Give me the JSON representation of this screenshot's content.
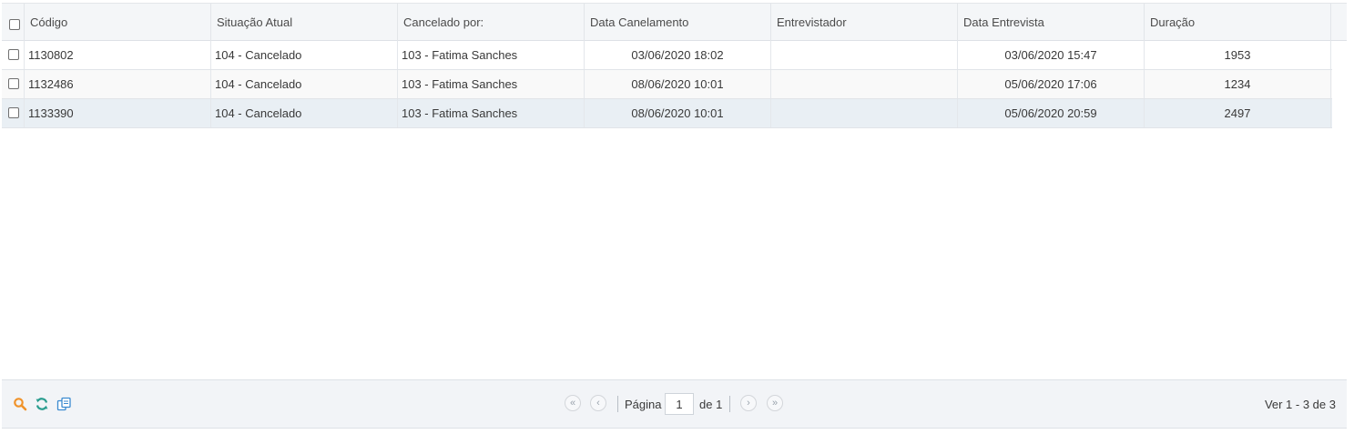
{
  "columns": {
    "codigo": "Código",
    "situacao": "Situação Atual",
    "cancelado_por": "Cancelado por:",
    "data_cancelamento": "Data Canelamento",
    "entrevistador": "Entrevistador",
    "data_entrevista": "Data Entrevista",
    "duracao": "Duração"
  },
  "rows": [
    {
      "codigo": "1130802",
      "situacao": "104 - Cancelado",
      "cancelado_por": "103 - Fatima Sanches",
      "data_cancelamento": "03/06/2020 18:02",
      "entrevistador": "",
      "data_entrevista": "03/06/2020 15:47",
      "duracao": "1953"
    },
    {
      "codigo": "1132486",
      "situacao": "104 - Cancelado",
      "cancelado_por": "103 - Fatima Sanches",
      "data_cancelamento": "08/06/2020 10:01",
      "entrevistador": "",
      "data_entrevista": "05/06/2020 17:06",
      "duracao": "1234"
    },
    {
      "codigo": "1133390",
      "situacao": "104 - Cancelado",
      "cancelado_por": "103 - Fatima Sanches",
      "data_cancelamento": "08/06/2020 10:01",
      "entrevistador": "",
      "data_entrevista": "05/06/2020 20:59",
      "duracao": "2497"
    }
  ],
  "pager": {
    "page_label": "Página",
    "page_value": "1",
    "of_label": "de 1",
    "records_info": "Ver 1 - 3 de 3"
  },
  "icons": {
    "search": "search-icon",
    "refresh": "refresh-icon",
    "copy": "copy-icon",
    "first": "first-page-icon",
    "prev": "prev-page-icon",
    "next": "next-page-icon",
    "last": "last-page-icon"
  },
  "colors": {
    "search_icon": "#f0932b",
    "refresh_icon": "#2a9d8f",
    "copy_icon": "#3b8ad0",
    "selected_row": "#e9eff4"
  }
}
